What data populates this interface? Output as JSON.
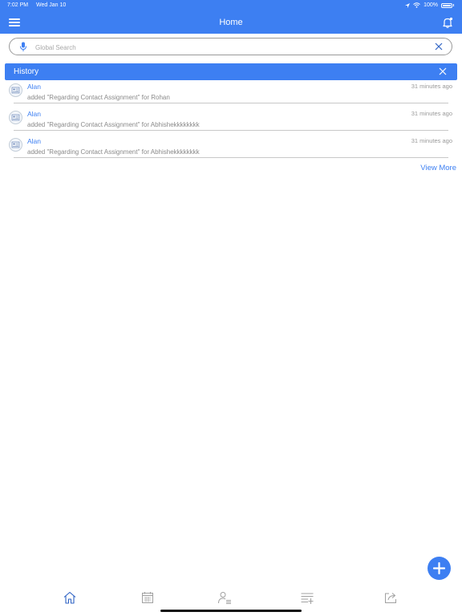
{
  "status_bar": {
    "time": "7:02 PM",
    "date": "Wed Jan 10",
    "battery": "100%"
  },
  "nav": {
    "title": "Home",
    "menu_icon": "hamburger-icon",
    "notification_icon": "bell-icon"
  },
  "search": {
    "placeholder": "Global Search",
    "value": ""
  },
  "history": {
    "title": "History",
    "items": [
      {
        "name": "Alan",
        "description": "added \"Regarding Contact Assignment\" for Rohan",
        "time": "31 minutes ago"
      },
      {
        "name": "Alan",
        "description": "added \"Regarding Contact Assignment\" for Abhishekkkkkkkk",
        "time": "31 minutes ago"
      },
      {
        "name": "Alan",
        "description": "added \"Regarding Contact Assignment\" for Abhishekkkkkkkk",
        "time": "31 minutes ago"
      }
    ],
    "view_more": "View More"
  },
  "tabs": [
    {
      "icon": "home-icon"
    },
    {
      "icon": "calendar-icon"
    },
    {
      "icon": "contacts-icon"
    },
    {
      "icon": "add-list-icon"
    },
    {
      "icon": "share-icon"
    }
  ],
  "colors": {
    "accent": "#3d7ff2",
    "active_tab": "#2f63c4",
    "inactive_tab": "#a0a0a0"
  }
}
